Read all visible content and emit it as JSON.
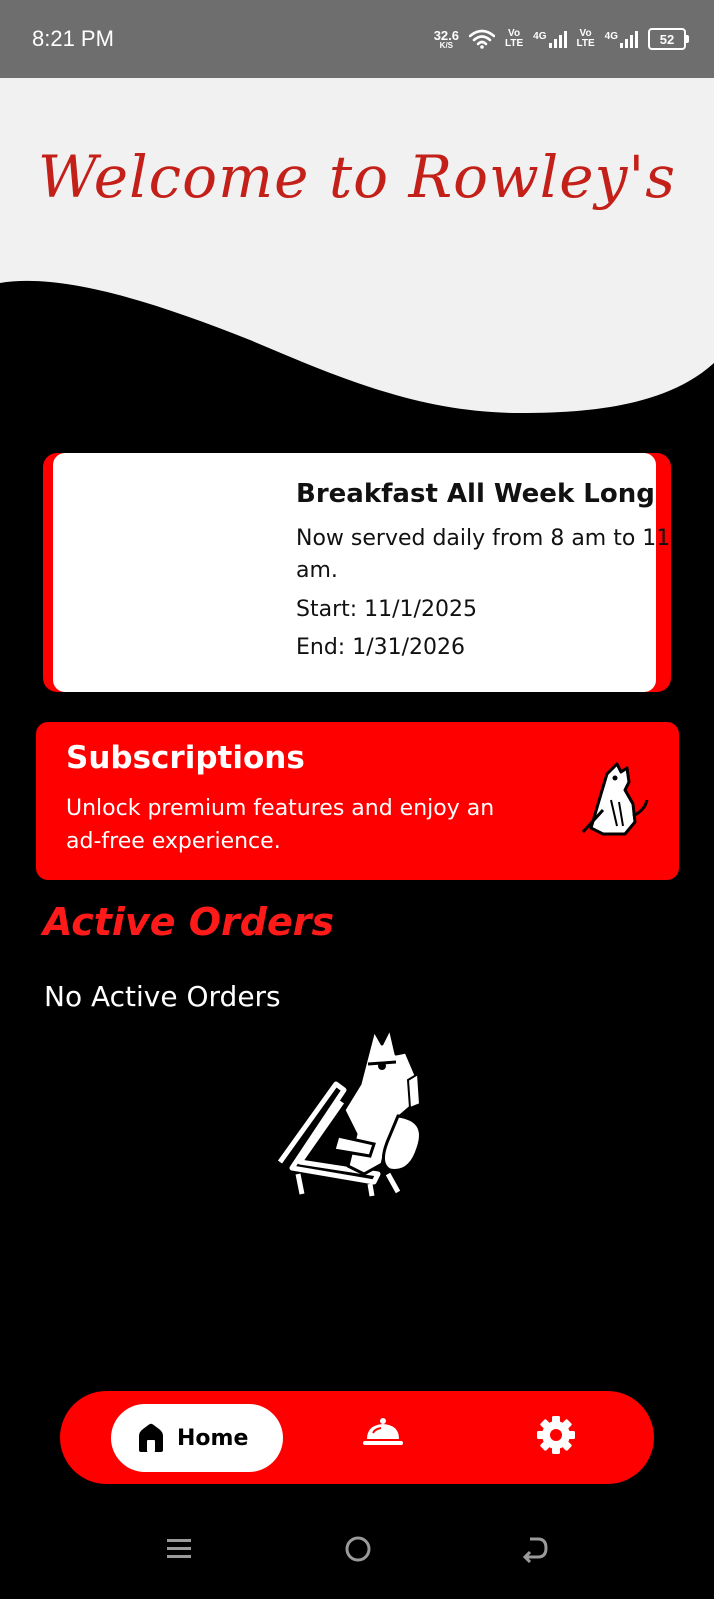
{
  "status_bar": {
    "time": "8:21 PM",
    "net_speed_value": "32.6",
    "net_speed_unit": "K/S",
    "volte1_top": "Vo",
    "volte1_bottom": "LTE",
    "sig1_tag": "4G",
    "volte2_top": "Vo",
    "volte2_bottom": "LTE",
    "sig2_tag": "4G",
    "battery": "52"
  },
  "header": {
    "welcome": "Welcome to Rowley's"
  },
  "promo": {
    "title": "Breakfast All Week Long",
    "description": "Now served daily from 8 am to 11 am.",
    "start": "Start: 11/1/2025",
    "end": "End: 1/31/2026"
  },
  "subscriptions": {
    "title": "Subscriptions",
    "description": "Unlock premium features and enjoy an ad-free experience."
  },
  "active_orders": {
    "title": "Active Orders",
    "empty_message": "No Active Orders"
  },
  "bottom_nav": {
    "home_label": "Home",
    "items": [
      {
        "icon": "home-icon",
        "active": true
      },
      {
        "icon": "service-bell-icon",
        "active": false
      },
      {
        "icon": "gear-icon",
        "active": false
      }
    ]
  },
  "colors": {
    "accent": "#ff0000",
    "title_red": "#c4201a",
    "background": "#000000",
    "header_bg": "#f1f1f1"
  }
}
